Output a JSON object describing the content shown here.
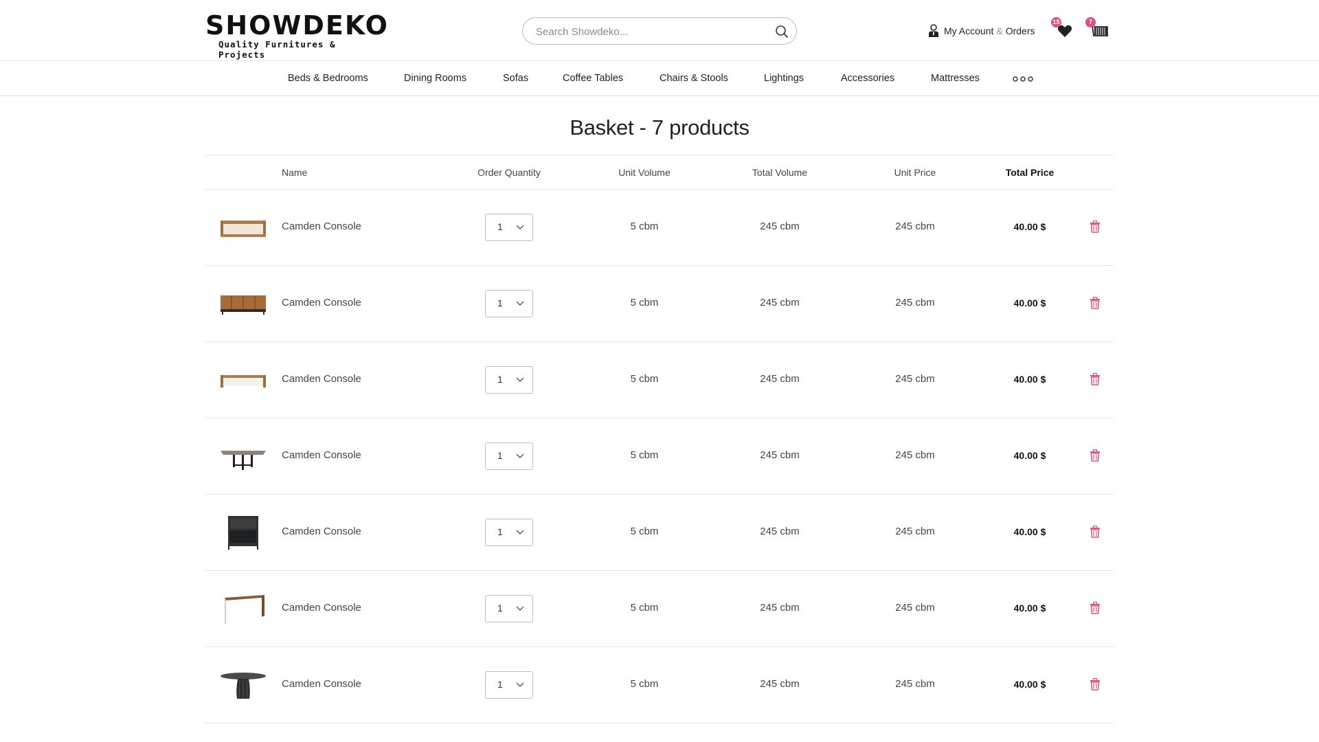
{
  "header": {
    "logo_word": "SHOWDEKO",
    "logo_tagline": "Quality Furnitures & Projects",
    "search_placeholder": "Search Showdeko...",
    "account": {
      "my_account": "My Account",
      "amp": "&",
      "orders": "Orders"
    },
    "favorites_count": "15",
    "cart_count": "7",
    "accent_color": "#e0517a"
  },
  "nav": {
    "items": [
      "Beds & Bedrooms",
      "Dining Rooms",
      "Sofas",
      "Coffee Tables",
      "Chairs & Stools",
      "Lightings",
      "Accessories",
      "Mattresses"
    ],
    "more_icon": "more-dots-icon"
  },
  "page": {
    "title": "Basket - 7 products"
  },
  "table": {
    "headers": {
      "name": "Name",
      "quantity": "Order Quantity",
      "unit_volume": "Unit Volume",
      "total_volume": "Total Volume",
      "unit_price": "Unit Price",
      "total_price": "Total Price"
    },
    "rows": [
      {
        "image": "console-table-oak",
        "name": "Camden Console",
        "quantity": "1",
        "unit_volume": "5 cbm",
        "total_volume": "245 cbm",
        "unit_price": "245 cbm",
        "total_price": "40.00 $"
      },
      {
        "image": "sideboard-wood",
        "name": "Camden Console",
        "quantity": "1",
        "unit_volume": "5 cbm",
        "total_volume": "245 cbm",
        "unit_price": "245 cbm",
        "total_price": "40.00 $"
      },
      {
        "image": "low-bench-wood",
        "name": "Camden Console",
        "quantity": "1",
        "unit_volume": "5 cbm",
        "total_volume": "245 cbm",
        "unit_price": "245 cbm",
        "total_price": "40.00 $"
      },
      {
        "image": "dining-table-metal-base",
        "name": "Camden Console",
        "quantity": "1",
        "unit_volume": "5 cbm",
        "total_volume": "245 cbm",
        "unit_price": "245 cbm",
        "total_price": "40.00 $"
      },
      {
        "image": "nightstand-dark",
        "name": "Camden Console",
        "quantity": "1",
        "unit_volume": "5 cbm",
        "total_volume": "245 cbm",
        "unit_price": "245 cbm",
        "total_price": "40.00 $"
      },
      {
        "image": "waterfall-console",
        "name": "Camden Console",
        "quantity": "1",
        "unit_volume": "5 cbm",
        "total_volume": "245 cbm",
        "unit_price": "245 cbm",
        "total_price": "40.00 $"
      },
      {
        "image": "round-dining-table",
        "name": "Camden Console",
        "quantity": "1",
        "unit_volume": "5 cbm",
        "total_volume": "245 cbm",
        "unit_price": "245 cbm",
        "total_price": "40.00 $"
      }
    ],
    "delete_icon": "trash-icon",
    "delete_color": "#e0517a"
  }
}
